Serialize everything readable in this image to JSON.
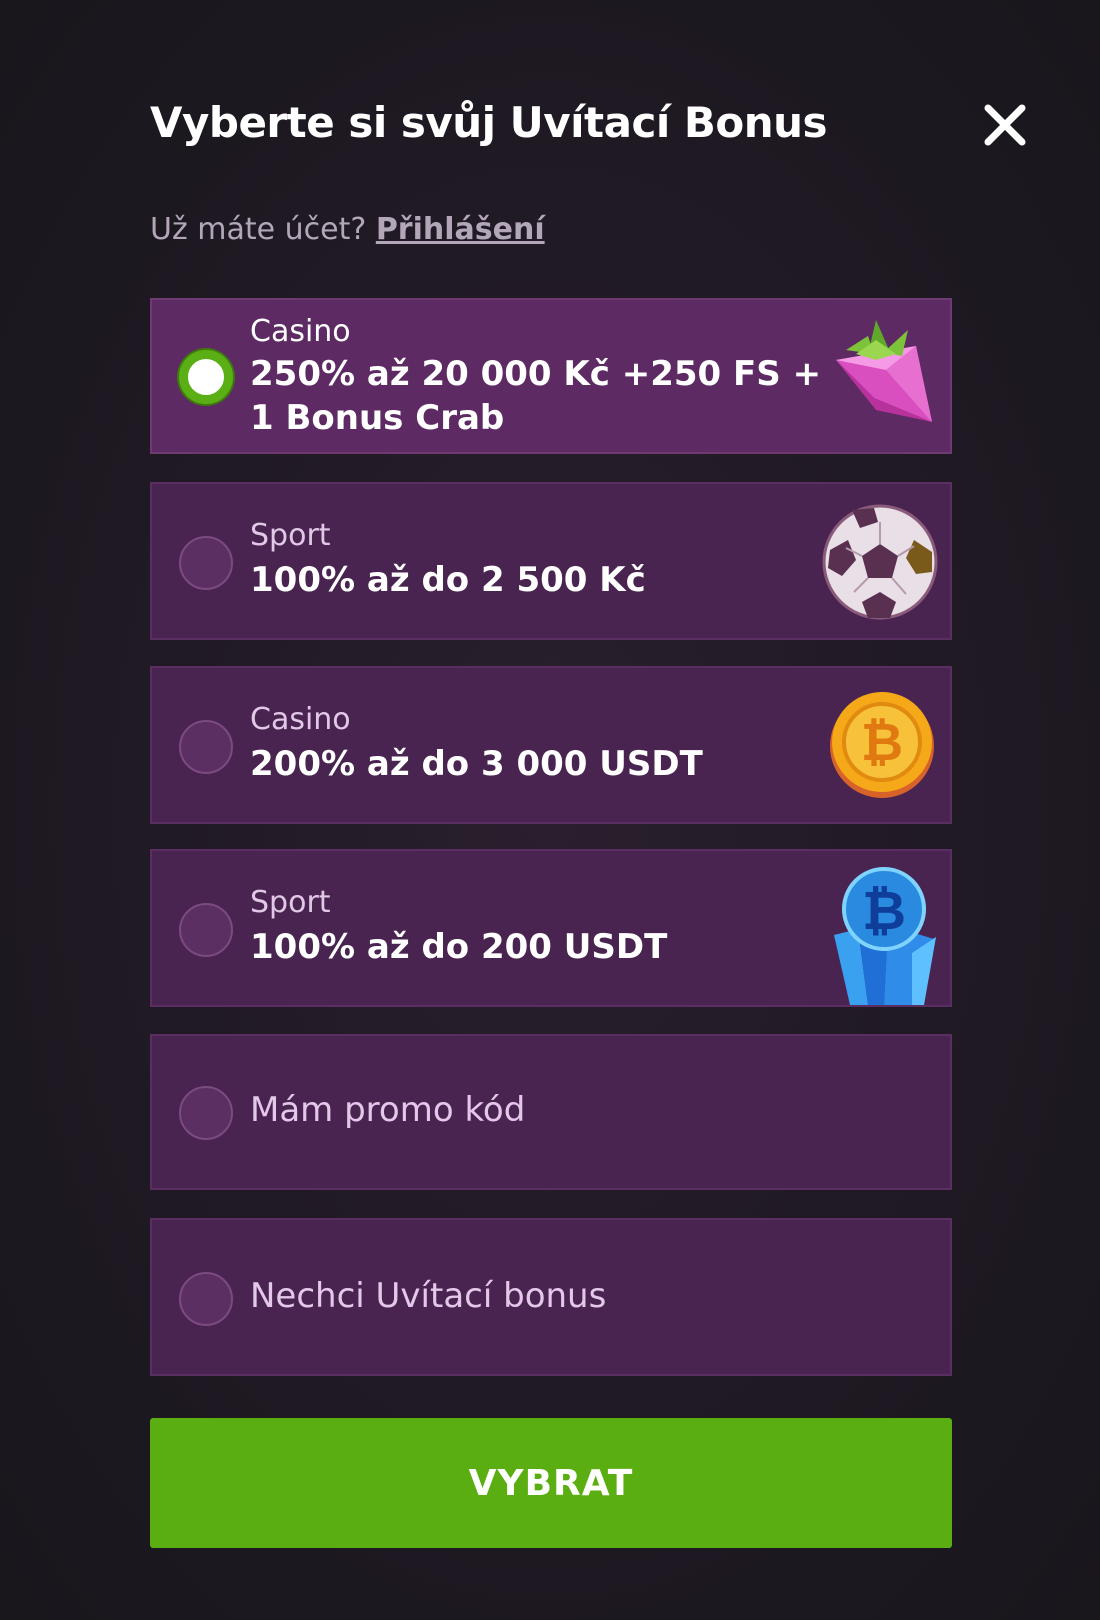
{
  "header": {
    "title": "Vyberte si svůj Uvítací Bonus",
    "close_icon": "close-icon"
  },
  "login": {
    "prompt": "Už máte účet?",
    "link": "Přihlášení"
  },
  "options": [
    {
      "category": "Casino",
      "line1": "250% až 20 000 Kč +250 FS +",
      "line2": "1 Bonus Crab",
      "icon": "strawberry-gem-icon",
      "selected": true
    },
    {
      "category": "Sport",
      "line1": "100% až do 2 500 Kč",
      "icon": "soccer-ball-icon",
      "selected": false
    },
    {
      "category": "Casino",
      "line1": "200% až do 3 000 USDT",
      "icon": "bitcoin-coin-icon",
      "selected": false
    },
    {
      "category": "Sport",
      "line1": "100% až do 200 USDT",
      "icon": "bitcoin-crystal-icon",
      "selected": false
    },
    {
      "label": "Mám promo kód",
      "selected": false
    },
    {
      "label": "Nechci Uvítací bonus",
      "selected": false
    }
  ],
  "submit": {
    "label": "VYBRAT"
  },
  "colors": {
    "accent": "#5aae12",
    "card": "#4a2450",
    "background": "#1c1820"
  }
}
